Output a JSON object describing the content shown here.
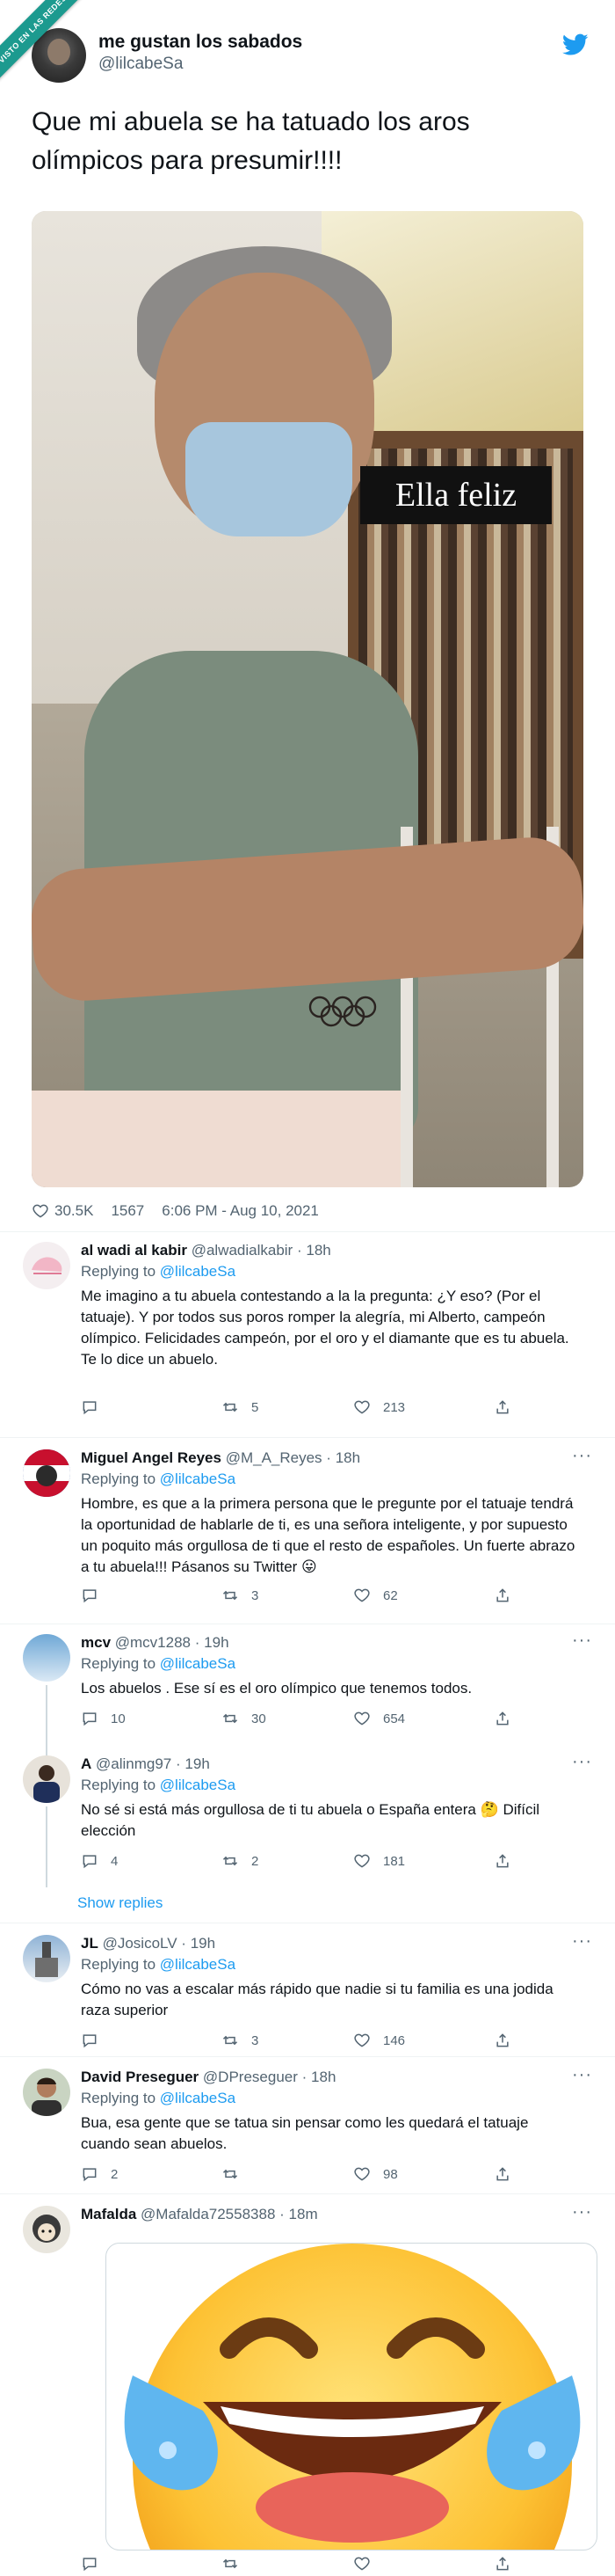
{
  "ribbon": "VISTO EN LAS REDES",
  "tweet": {
    "author_name": "me gustan los sabados",
    "author_handle": "@lilcabeSa",
    "text": "Que mi abuela se ha tatuado los aros olímpicos para presumir!!!!",
    "photo_caption": "Ella feliz",
    "likes": "30.5K",
    "retweets": "1567",
    "timestamp": "6:06 PM - Aug 10, 2021"
  },
  "replies": [
    {
      "name": "al wadi al kabir",
      "handle": "@alwadialkabir",
      "time": "18h",
      "replying_label": "Replying to",
      "replying_to": "@lilcabeSa",
      "text": "Me imagino a tu abuela contestando a la la pregunta: ¿Y eso? (Por el tatuaje). Y por todos sus poros romper la alegría, mi Alberto, campeón olímpico. Felicidades campeón, por el oro y el diamante que es tu abuela. Te lo dice un abuelo.",
      "replies": "",
      "retweets": "5",
      "likes": "213"
    },
    {
      "name": "Miguel Angel Reyes",
      "handle": "@M_A_Reyes",
      "time": "18h",
      "replying_label": "Replying to",
      "replying_to": "@lilcabeSa",
      "text": "Hombre, es que a la primera persona que le pregunte por el tatuaje tendrá la oportunidad de hablarle de ti, es una señora inteligente, y por supuesto un poquito más orgullosa de ti que el resto de españoles. Un fuerte abrazo a tu abuela!!! Pásanos su Twitter 😛",
      "replies": "",
      "retweets": "3",
      "likes": "62"
    },
    {
      "name": "mcv",
      "handle": "@mcv1288",
      "time": "19h",
      "replying_label": "Replying to",
      "replying_to": "@lilcabeSa",
      "text": "Los abuelos . Ese sí es el oro olímpico que tenemos todos.",
      "replies": "10",
      "retweets": "30",
      "likes": "654"
    },
    {
      "name": "A",
      "handle": "@alinmg97",
      "time": "19h",
      "replying_label": "Replying to",
      "replying_to": "@lilcabeSa",
      "text": "No sé si está más orgullosa de ti tu abuela o España entera 🤔 Difícil elección",
      "replies": "4",
      "retweets": "2",
      "likes": "181"
    },
    {
      "name": "JL",
      "handle": "@JosicoLV",
      "time": "19h",
      "replying_label": "Replying to",
      "replying_to": "@lilcabeSa",
      "text": "Cómo no vas a escalar más rápido que nadie si tu familia es una jodida raza superior",
      "replies": "",
      "retweets": "3",
      "likes": "146"
    },
    {
      "name": "David Preseguer",
      "handle": "@DPreseguer",
      "time": "18h",
      "replying_label": "Replying to",
      "replying_to": "@lilcabeSa",
      "text": "Bua, esa gente que se tatua sin pensar como les quedará el tatuaje cuando sean abuelos.",
      "replies": "2",
      "retweets": "",
      "likes": "98"
    },
    {
      "name": "Mafalda",
      "handle": "@Mafalda72558388",
      "time": "18m",
      "replying_label": "",
      "replying_to": "",
      "text": "",
      "replies": "",
      "retweets": "",
      "likes": ""
    }
  ],
  "show_replies": "Show replies",
  "more_icon": "more-icon",
  "colors": {
    "link": "#1d9bf0",
    "muted": "#536471",
    "ribbon": "#1c9a8f"
  }
}
